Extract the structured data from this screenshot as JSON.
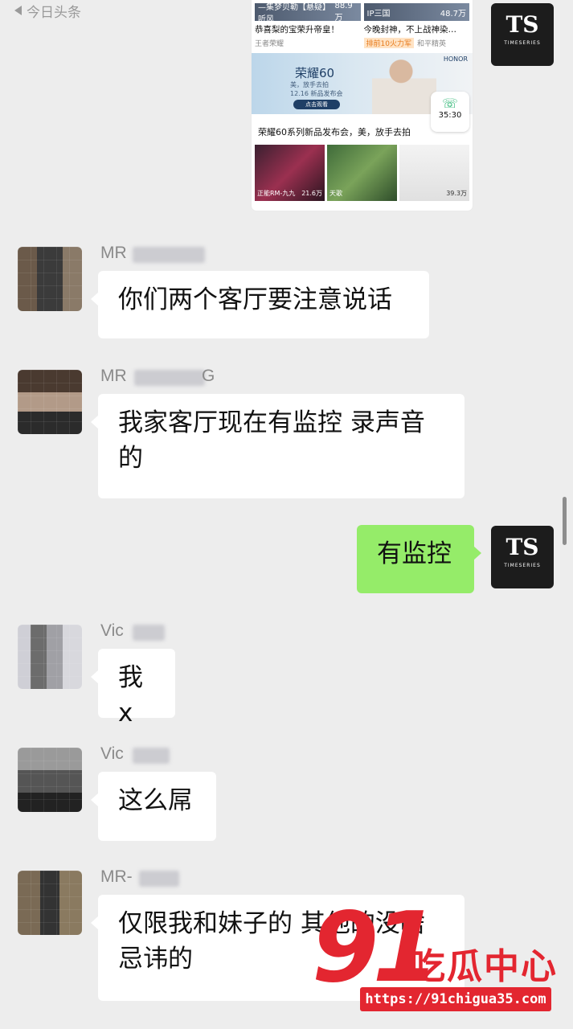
{
  "status_bar": {
    "back_label": "今日头条"
  },
  "shared_image": {
    "thumb_top_left": "—集梦贝勒【悬疑】听风",
    "thumb_top_left_views": "88.9万",
    "thumb_top_right": "IP三国",
    "thumb_top_right_views": "48.7万",
    "caption_left": "恭喜梨的宝荣升帝皇！",
    "caption_right": "今晚封神，不上战神染…",
    "sub_left": "王者荣耀",
    "sub_right_tag": "排前10火力军",
    "sub_right": "和平精英",
    "banner_brand": "荣耀60",
    "banner_sub": "美，放手去拍",
    "banner_date": "12.16 新品发布会",
    "banner_button": "点击观看",
    "banner_logo": "HONOR",
    "call_duration": "35:30",
    "launch_caption": "荣耀60系列新品发布会，美，放手去拍",
    "game1_name": "正能RM-九九",
    "game1_views": "21.6万",
    "game2_name": "天歌",
    "game3_views": "39.3万"
  },
  "logo": {
    "mark": "TS",
    "text": "TIMESERIES"
  },
  "messages": [
    {
      "sender": "MR",
      "text": "你们两个客厅要注意说话"
    },
    {
      "sender": "MR",
      "sender_tail": "G",
      "text_line1": "我家客厅现在有监控 录声音",
      "text_line2": "的"
    },
    {
      "text": "有监控"
    },
    {
      "sender": "Vic",
      "text": "我x"
    },
    {
      "sender": "Vic",
      "text": "这么屌"
    },
    {
      "sender": "MR-",
      "text_line1": "仅限我和妹子的 其他的没啥",
      "text_line2": "忌讳的"
    }
  ],
  "watermark": {
    "num": "91",
    "name": "吃瓜中心",
    "url": "https://91chigua35.com"
  },
  "colors": {
    "background": "#ededed",
    "self_bubble": "#95ec69",
    "other_bubble": "#ffffff",
    "watermark": "#e32630"
  }
}
